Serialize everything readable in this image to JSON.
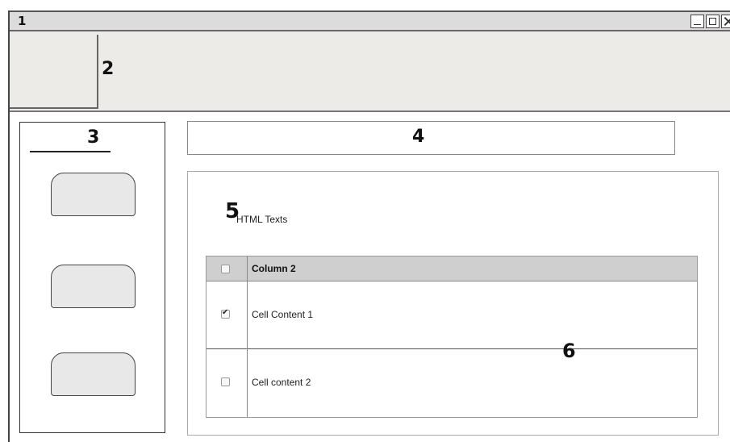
{
  "window": {
    "title": "1",
    "controls": [
      "minimize-icon",
      "maximize-icon",
      "close-icon"
    ]
  },
  "markers": {
    "m2": "2",
    "m3": "3",
    "m4": "4",
    "m5": "5",
    "m6": "6"
  },
  "sidebar": {
    "buttons": [
      "",
      "",
      ""
    ]
  },
  "content": {
    "html_text": "HTML Texts"
  },
  "grid": {
    "header": {
      "checked": false,
      "column2": "Column 2"
    },
    "rows": [
      {
        "checked": true,
        "text": "Cell Content 1"
      },
      {
        "checked": false,
        "text": "Cell content 2"
      }
    ]
  }
}
